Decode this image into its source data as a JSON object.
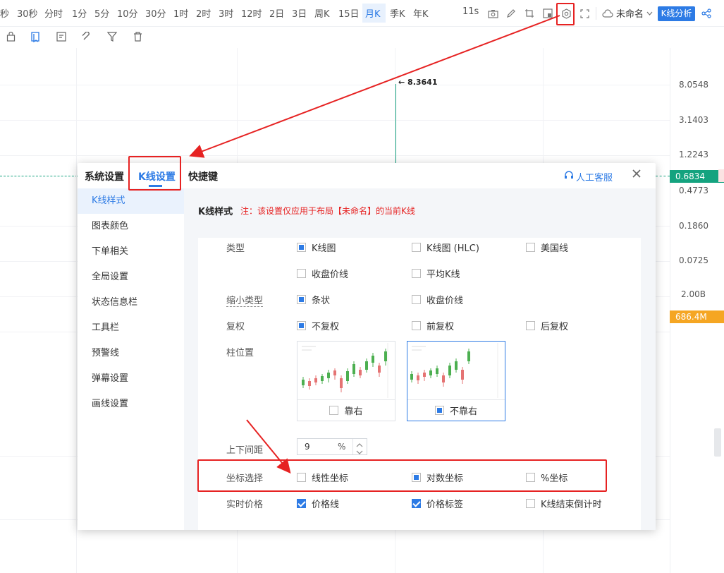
{
  "periods": [
    "秒",
    "30秒",
    "分时",
    "1分",
    "5分",
    "10分",
    "30分",
    "1时",
    "2时",
    "3时",
    "12时",
    "2日",
    "3日",
    "周K",
    "15日",
    "月K",
    "季K",
    "年K"
  ],
  "active_period": "月K",
  "topbar": {
    "time_label": "11s",
    "layout_name": "未命名",
    "analysis_button": "K线分析"
  },
  "axis_labels": [
    "8.0548",
    "3.1403",
    "1.2243",
    "0.4773",
    "0.1860",
    "0.0725",
    "2.00B"
  ],
  "price_tag": "0.6834",
  "volume_tag": "686.4M",
  "high_marker": "← 8.3641",
  "dialog": {
    "tabs": [
      "系统设置",
      "K线设置",
      "快捷键"
    ],
    "support_label": "人工客服",
    "side_items": [
      "K线样式",
      "图表颜色",
      "下单相关",
      "全局设置",
      "状态信息栏",
      "工具栏",
      "预警线",
      "弹幕设置",
      "画线设置"
    ],
    "section_title": "K线样式",
    "section_note": "注：该设置仅应用于布局【未命名】的当前K线",
    "rows": {
      "type": {
        "label": "类型",
        "options": [
          "K线图",
          "K线图 (HLC)",
          "美国线",
          "收盘价线",
          "平均K线"
        ]
      },
      "shrink": {
        "label": "缩小类型",
        "options": [
          "条状",
          "收盘价线"
        ]
      },
      "adjust": {
        "label": "复权",
        "options": [
          "不复权",
          "前复权",
          "后复权"
        ]
      },
      "position": {
        "label": "柱位置",
        "options": [
          "靠右",
          "不靠右"
        ]
      },
      "spacing": {
        "label": "上下间距",
        "value": "9",
        "unit": "%"
      },
      "scale": {
        "label": "坐标选择",
        "options": [
          "线性坐标",
          "对数坐标",
          "%坐标"
        ]
      },
      "realtime": {
        "label": "实时价格",
        "options": [
          "价格线",
          "价格标签",
          "K线结束倒计时"
        ]
      }
    }
  }
}
